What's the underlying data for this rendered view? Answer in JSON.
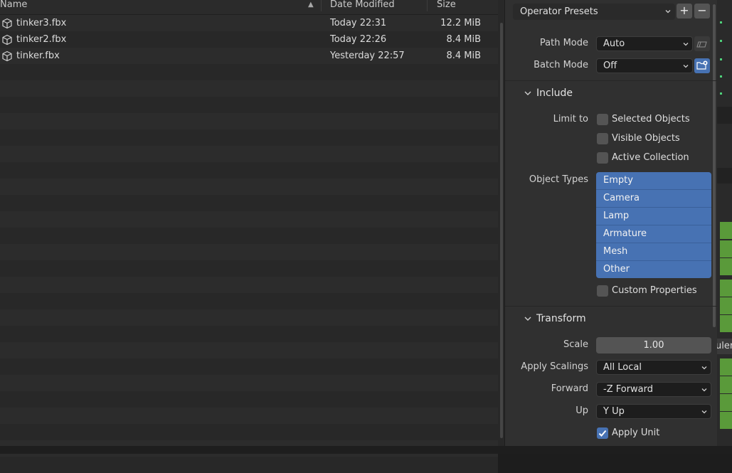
{
  "file_list": {
    "columns": {
      "name": "Name",
      "date": "Date Modified",
      "size": "Size"
    },
    "files": [
      {
        "name": "tinker3.fbx",
        "date": "Today 22:31",
        "size": "12.2 MiB"
      },
      {
        "name": "tinker2.fbx",
        "date": "Today 22:26",
        "size": "8.4 MiB"
      },
      {
        "name": "tinker.fbx",
        "date": "Yesterday 22:57",
        "size": "8.4 MiB"
      }
    ]
  },
  "operator_presets": {
    "label": "Operator Presets",
    "add": "+",
    "remove": "−"
  },
  "path_mode": {
    "label": "Path Mode",
    "value": "Auto"
  },
  "batch_mode": {
    "label": "Batch Mode",
    "value": "Off"
  },
  "include": {
    "title": "Include",
    "limit_to_label": "Limit to",
    "limits": [
      {
        "label": "Selected Objects",
        "checked": false
      },
      {
        "label": "Visible Objects",
        "checked": false
      },
      {
        "label": "Active Collection",
        "checked": false
      }
    ],
    "object_types_label": "Object Types",
    "object_types": [
      "Empty",
      "Camera",
      "Lamp",
      "Armature",
      "Mesh",
      "Other"
    ],
    "custom_properties": {
      "label": "Custom Properties",
      "checked": false
    }
  },
  "transform": {
    "title": "Transform",
    "scale_label": "Scale",
    "scale_value": "1.00",
    "apply_scalings_label": "Apply Scalings",
    "apply_scalings_value": "All Local",
    "forward_label": "Forward",
    "forward_value": "-Z Forward",
    "up_label": "Up",
    "up_value": "Y Up",
    "apply_unit": {
      "label": "Apply Unit",
      "checked": true
    }
  },
  "edge_fragment": "uler",
  "colors": {
    "accent": "#4772b3",
    "panel": "#303030",
    "field": "#1d1d1d",
    "edge_green": "#5a9a3a"
  }
}
